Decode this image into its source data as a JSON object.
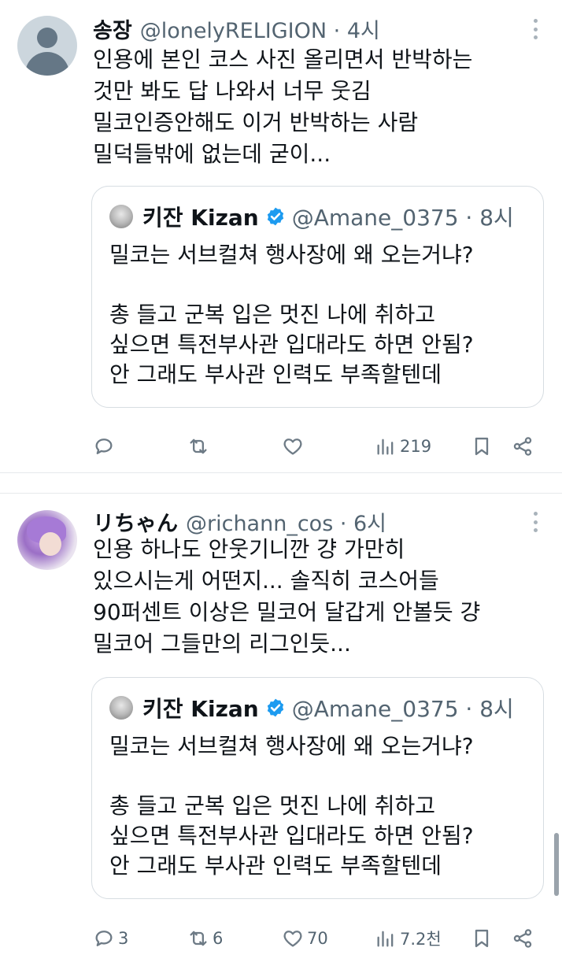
{
  "tweets": [
    {
      "display_name": "송장",
      "handle_meta": "@lonelyRELIGION · 4시",
      "avatar": "default-avatar",
      "text_lines": [
        "인용에 본인 코스 사진 올리면서 반박하는",
        "것만 봐도 답 나와서 너무 웃김",
        "밀코인증안해도 이거 반박하는 사람",
        "밀덕들밖에 없는데 굳이..."
      ],
      "quote": {
        "name": "키잔 Kizan",
        "handle_meta": "@Amane_0375 · 8시",
        "text_lines": [
          "밀코는 서브컬쳐 행사장에 왜 오는거냐?",
          "",
          "총 들고 군복 입은 멋진 나에 취하고",
          "싶으면 특전부사관 입대라도 하면 안됨?",
          "안 그래도 부사관 인력도 부족할텐데"
        ]
      },
      "actions": {
        "reply": "",
        "retweet": "",
        "like": "",
        "views": "219"
      }
    },
    {
      "display_name": "リちゃん",
      "handle_meta": "@richann_cos · 6시",
      "avatar": "photo-avatar",
      "text_lines": [
        "인용 하나도 안웃기니깐 걍 가만히",
        "있으시는게 어떤지... 솔직히 코스어들",
        "90퍼센트 이상은 밀코어 달갑게 안볼듯 걍",
        "밀코어 그들만의 리그인듯..."
      ],
      "quote": {
        "name": "키잔 Kizan",
        "handle_meta": "@Amane_0375 · 8시",
        "text_lines": [
          "밀코는 서브컬쳐 행사장에 왜 오는거냐?",
          "",
          "총 들고 군복 입은 멋진 나에 취하고",
          "싶으면 특전부사관 입대라도 하면 안됨?",
          "안 그래도 부사관 인력도 부족할텐데"
        ]
      },
      "actions": {
        "reply": "3",
        "retweet": "6",
        "like": "70",
        "views": "7.2천"
      }
    }
  ],
  "icons": {
    "reply": "reply-icon",
    "retweet": "retweet-icon",
    "like": "heart-icon",
    "views": "views-chart-icon",
    "bookmark": "bookmark-icon",
    "share": "share-icon",
    "more": "more-vertical-icon",
    "verified": "verified-badge-icon"
  },
  "colors": {
    "text": "#0f1419",
    "secondary": "#536471",
    "verified": "#1d9bf0",
    "border": "#d7dde2"
  }
}
